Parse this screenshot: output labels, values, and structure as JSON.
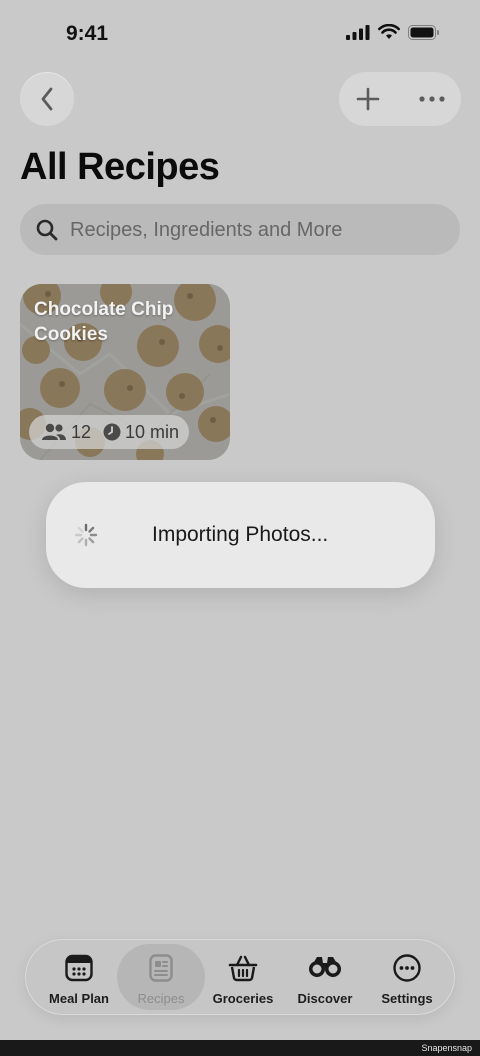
{
  "status": {
    "time": "9:41"
  },
  "header": {
    "title": "All Recipes"
  },
  "search": {
    "placeholder": "Recipes, Ingredients and More"
  },
  "recipe": {
    "title": "Chocolate Chip Cookies",
    "servings": "12",
    "time": "10 min"
  },
  "toast": {
    "text": "Importing Photos..."
  },
  "tabs": [
    {
      "label": "Meal Plan",
      "icon": "calendar-icon"
    },
    {
      "label": "Recipes",
      "icon": "recipe-card-icon"
    },
    {
      "label": "Groceries",
      "icon": "basket-icon"
    },
    {
      "label": "Discover",
      "icon": "binoculars-icon"
    },
    {
      "label": "Settings",
      "icon": "ellipsis-circle-icon"
    }
  ],
  "watermark": "Snapensnap"
}
